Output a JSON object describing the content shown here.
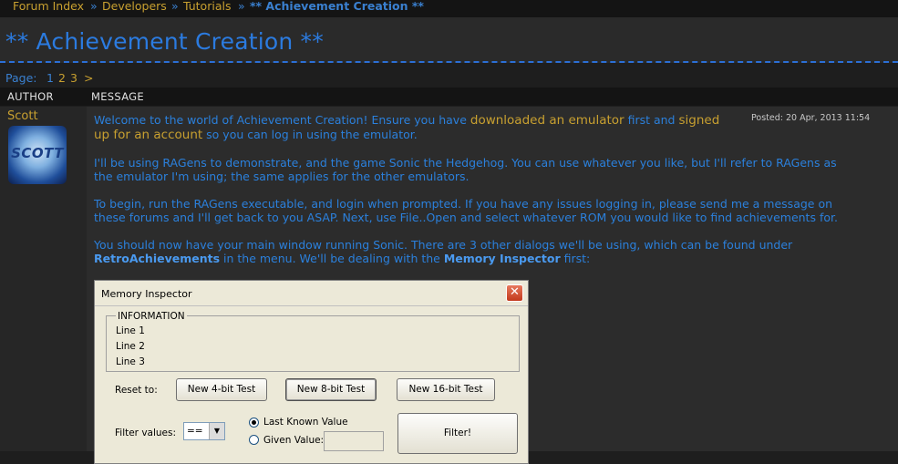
{
  "breadcrumb": {
    "forum_index": "Forum Index",
    "sep": "»",
    "developers": "Developers",
    "tutorials": "Tutorials",
    "current": "** Achievement Creation **"
  },
  "page_title": "** Achievement Creation **",
  "pagination": {
    "label": "Page:",
    "current": "1",
    "pages": [
      "2",
      "3"
    ],
    "next": ">"
  },
  "columns": {
    "author": "AUTHOR",
    "message": "MESSAGE"
  },
  "post": {
    "author": "Scott",
    "avatar_text": "SCOTT",
    "posted": "Posted: 20 Apr, 2013 11:54",
    "p1_a": "Welcome to the world of Achievement Creation! Ensure you have",
    "p1_link1": "downloaded an emulator",
    "p1_b": "first and",
    "p1_link2": "signed",
    "p1_link2b": "up for an account",
    "p1_c": "so you can log in using the emulator.",
    "p2_l1": "I'll be using RAGens to demonstrate, and the game Sonic the Hedgehog. You can use whatever you like, but I'll refer to RAGens as",
    "p2_l2": "the emulator I'm using; the same applies for the other emulators.",
    "p3_l1": "To begin, run the RAGens executable, and login when prompted. If you have any issues logging in, please send me a message on",
    "p3_l2": "these forums and I'll get back to you ASAP. Next, use File..Open and select whatever ROM you would like to find achievements for.",
    "p4_l1": "You should now have your main window running Sonic. There are 3 other dialogs we'll be using, which can be found under",
    "p4_bold1": "RetroAchievements",
    "p4_mid": "in the menu. We'll be dealing with the",
    "p4_bold2": "Memory Inspector",
    "p4_end": "first:"
  },
  "dialog": {
    "title": "Memory Inspector",
    "close": "✕",
    "info_legend": "INFORMATION",
    "info_lines": [
      "Line 1",
      "Line 2",
      "Line 3"
    ],
    "reset_label": "Reset to:",
    "btn_4bit": "New 4-bit Test",
    "btn_8bit": "New 8-bit Test",
    "btn_16bit": "New 16-bit Test",
    "filter_label": "Filter values:",
    "filter_op": "==",
    "radio_last": "Last Known Value",
    "radio_given": "Given Value:",
    "filter_btn": "Filter!"
  },
  "colors": {
    "link": "#c8a030",
    "text": "#2b80dc",
    "background": "#1e1e1e"
  }
}
